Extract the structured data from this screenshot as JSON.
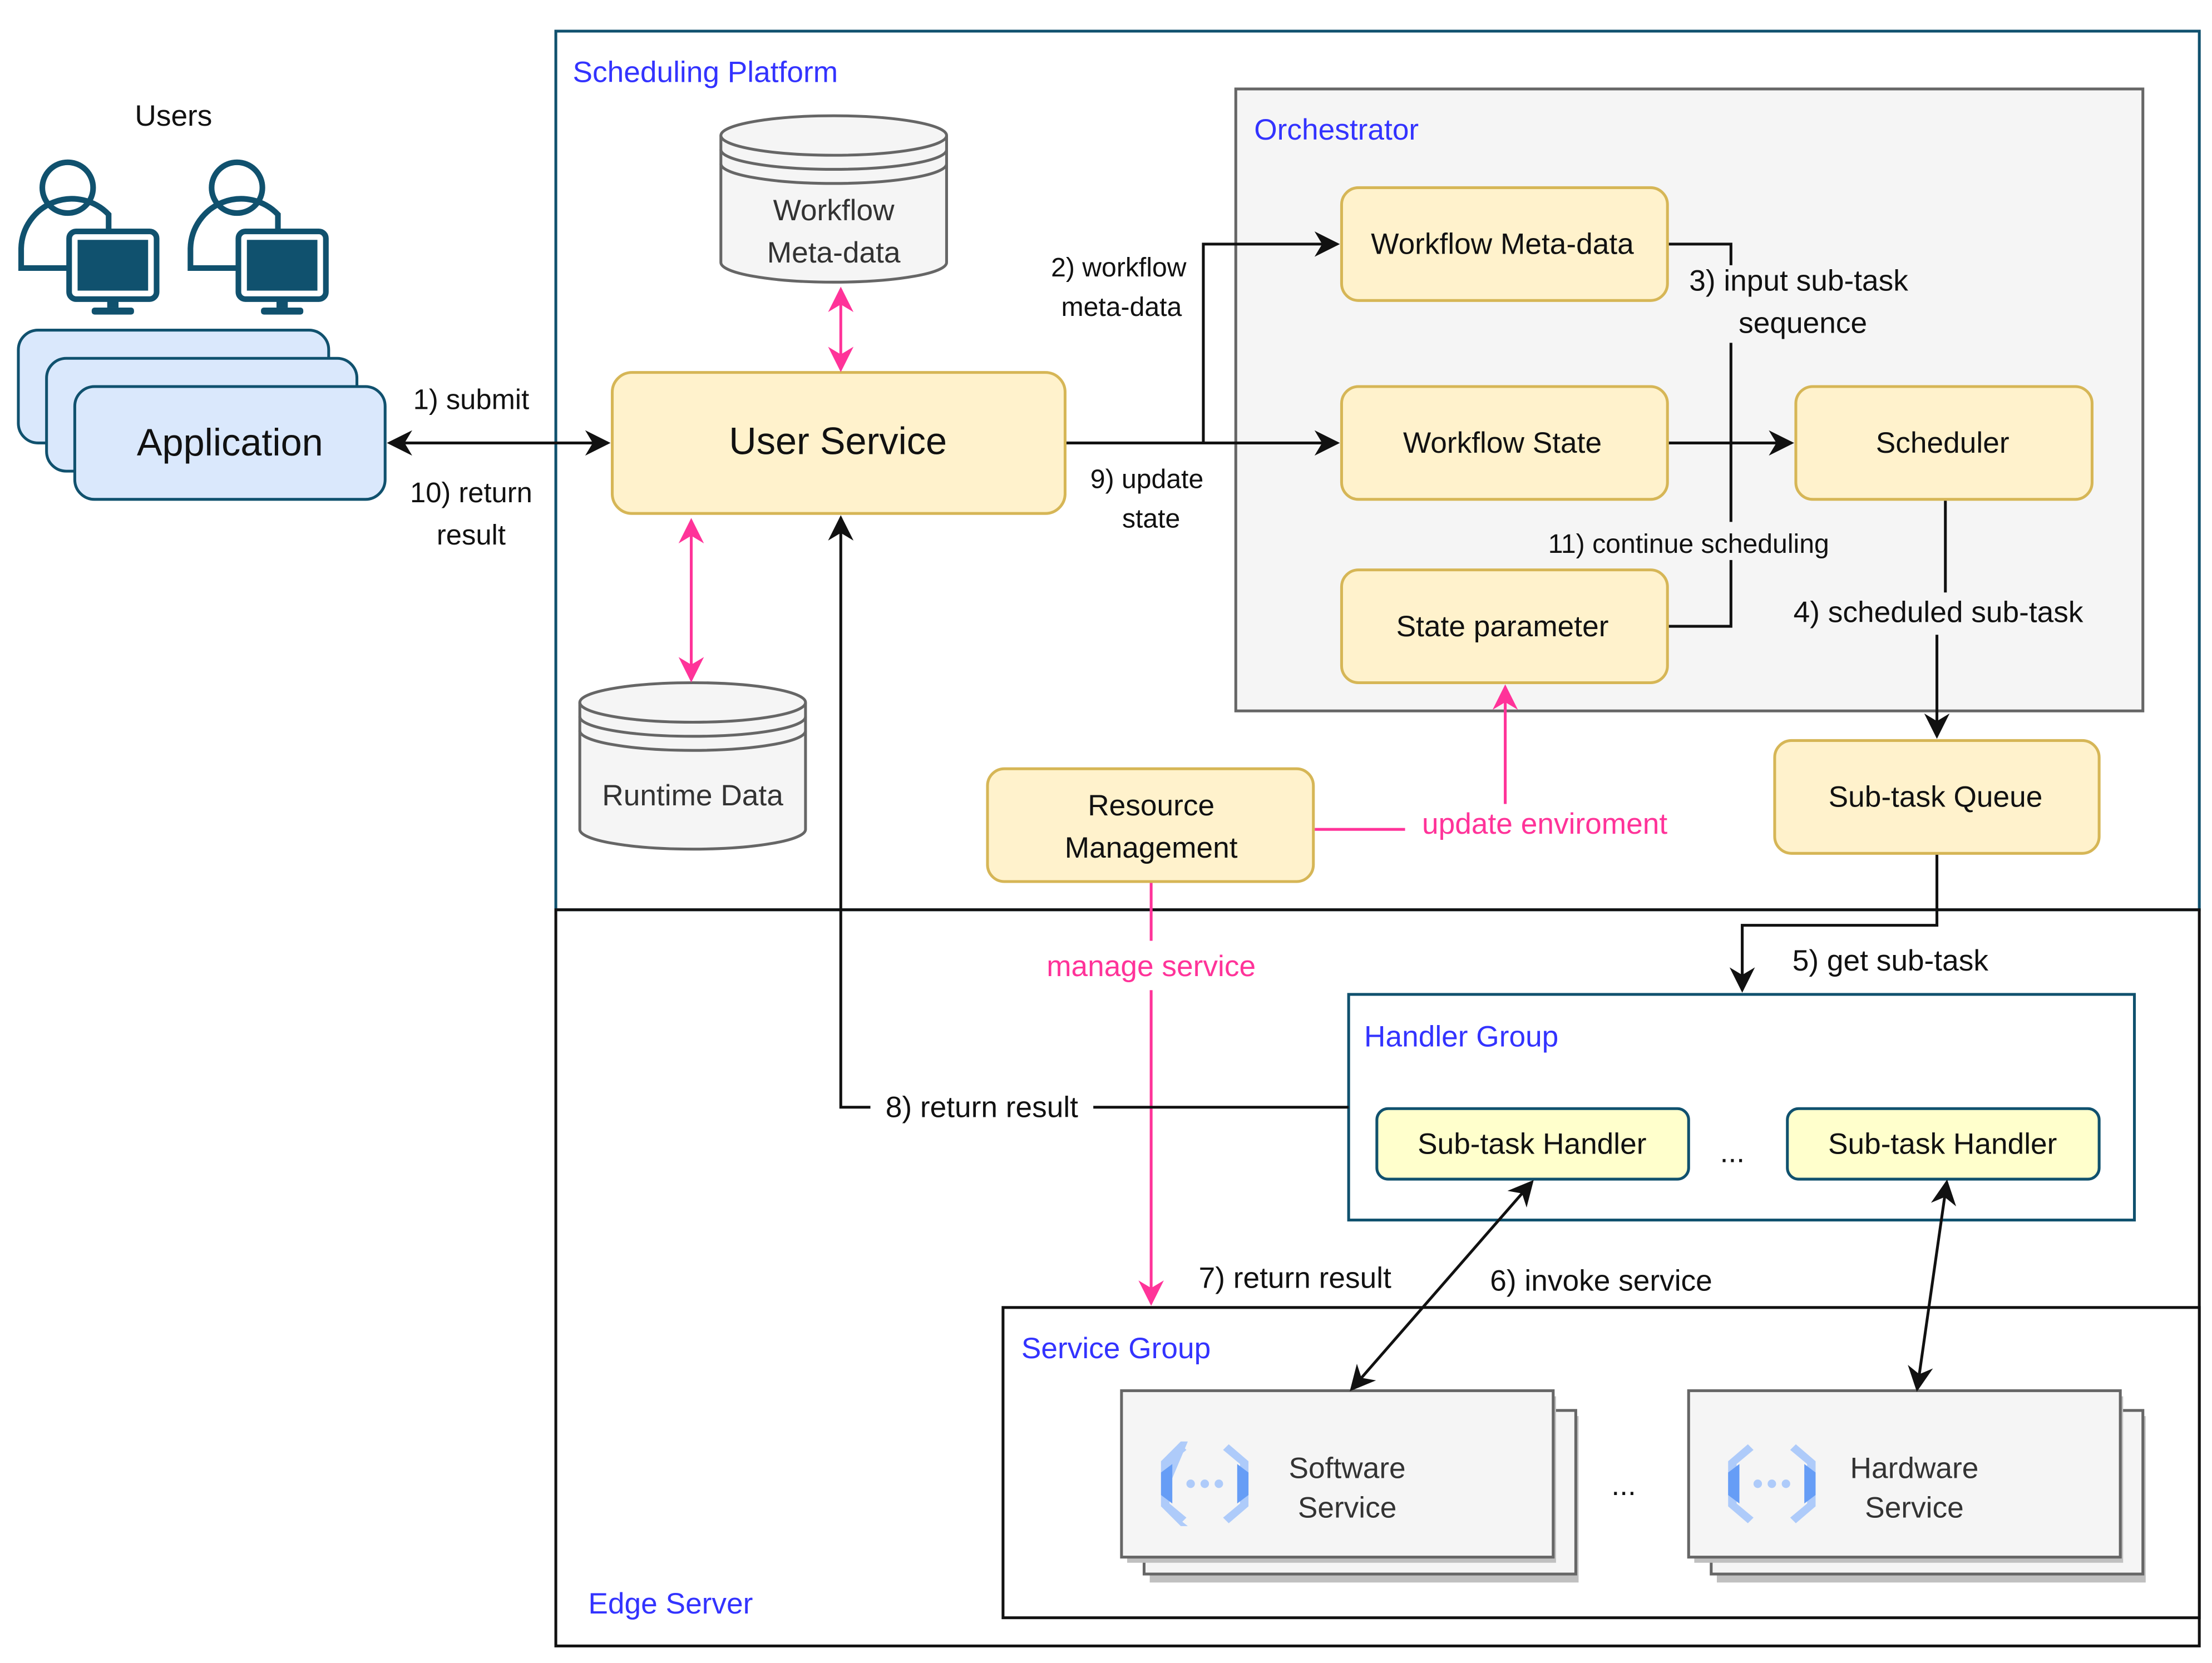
{
  "users": {
    "label": "Users"
  },
  "application": {
    "label": "Application"
  },
  "containers": {
    "scheduling_platform": "Scheduling Platform",
    "orchestrator": "Orchestrator",
    "edge_server": "Edge Server",
    "handler_group": "Handler Group",
    "service_group": "Service Group"
  },
  "nodes": {
    "user_service": "User Service",
    "workflow_metadata_db": [
      "Workflow",
      "Meta-data"
    ],
    "runtime_data_db": "Runtime Data",
    "workflow_metadata": "Workflow Meta-data",
    "workflow_state": "Workflow State",
    "scheduler": "Scheduler",
    "state_parameter": "State parameter",
    "subtask_queue": "Sub-task Queue",
    "resource_management": [
      "Resource",
      "Management"
    ],
    "subtask_handler_1": "Sub-task Handler",
    "subtask_handler_2": "Sub-task Handler",
    "handler_ellipsis": "...",
    "software_service": [
      "Software",
      "Service"
    ],
    "hardware_service": [
      "Hardware",
      "Service"
    ],
    "service_ellipsis": "..."
  },
  "edges": {
    "submit": "1) submit",
    "return_result_10": [
      "10) return",
      "result"
    ],
    "workflow_metadata": [
      "2) workflow",
      "meta-data"
    ],
    "input_subtask_sequence": [
      "3) input sub-task",
      "sequence"
    ],
    "update_state": [
      "9) update",
      "state"
    ],
    "continue_scheduling": "11) continue scheduling",
    "scheduled_subtask": "4) scheduled sub-task",
    "get_subtask": "5) get sub-task",
    "invoke_service": "6) invoke service",
    "return_result_7": "7) return result",
    "return_result_8": "8) return result",
    "update_environment": "update enviroment",
    "manage_service": "manage service"
  },
  "colors": {
    "container_label": "#3333ff",
    "pink_edge": "#ff3399",
    "node_fill": "#fff2cc",
    "node_stroke": "#d6b656",
    "accent_dark": "#10516e",
    "service_icon": "#669df6"
  }
}
